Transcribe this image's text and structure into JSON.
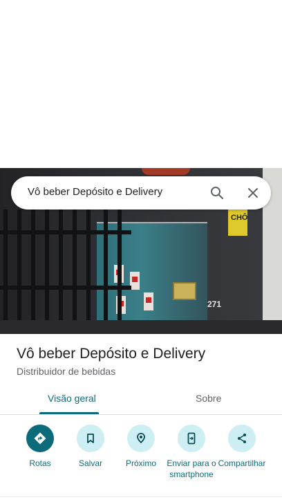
{
  "search": {
    "query": "Vô beber Depósito e Delivery"
  },
  "place": {
    "name": "Vô beber Depósito e Delivery",
    "category": "Distribuidor de bebidas"
  },
  "photo_sign": {
    "text": "CHÔ",
    "number": "271"
  },
  "tabs": [
    {
      "label": "Visão geral",
      "active": true
    },
    {
      "label": "Sobre",
      "active": false
    }
  ],
  "actions": [
    {
      "label": "Rotas",
      "icon": "directions-icon"
    },
    {
      "label": "Salvar",
      "icon": "bookmark-icon"
    },
    {
      "label": "Próximo",
      "icon": "nearby-icon"
    },
    {
      "label": "Enviar para o smartphone",
      "icon": "send-to-phone-icon"
    },
    {
      "label": "Compartilhar",
      "icon": "share-icon"
    }
  ],
  "colors": {
    "accent": "#0b6b7a",
    "chip": "#cdeff4"
  }
}
